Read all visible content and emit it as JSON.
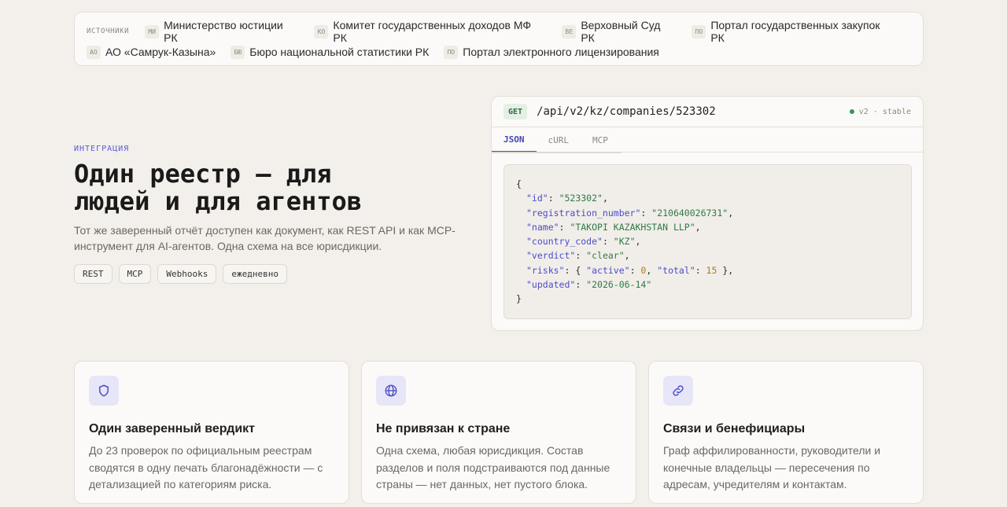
{
  "sources": {
    "label": "ИСТОЧНИКИ",
    "row1": [
      {
        "abbr": "МИ",
        "name": "Министерство юстиции РК"
      },
      {
        "abbr": "КО",
        "name": "Комитет государственных доходов МФ РК"
      },
      {
        "abbr": "ВЕ",
        "name": "Верховный Суд РК"
      },
      {
        "abbr": "ПО",
        "name": "Портал государственных закупок РК"
      }
    ],
    "row2": [
      {
        "abbr": "АО",
        "name": "АО «Самрук-Казына»"
      },
      {
        "abbr": "БЮ",
        "name": "Бюро национальной статистики РК"
      },
      {
        "abbr": "ПО",
        "name": "Портал электронного лицензирования"
      }
    ]
  },
  "integration": {
    "eyebrow": "ИНТЕГРАЦИЯ",
    "title_line1": "Один реестр — для",
    "title_line2": "людей и для агентов",
    "description": "Тот же заверенный отчёт доступен как документ, как REST API и как MCP-инструмент для AI-агентов. Одна схема на все юрисдикции.",
    "chips": [
      "REST",
      "MCP",
      "Webhooks",
      "ежедневно"
    ]
  },
  "api": {
    "method": "GET",
    "endpoint": "/api/v2/kz/companies/523302",
    "version": "v2 · stable",
    "status_color": "#2e9a58",
    "tabs": [
      "JSON",
      "cURL",
      "MCP"
    ],
    "active_tab": "JSON",
    "json": {
      "id": "\"523302\"",
      "registration_number": "\"210640026731\"",
      "name": "\"TAKOPI KAZAKHSTAN LLP\"",
      "country_code": "\"KZ\"",
      "verdict": "\"clear\"",
      "risks_active": "0",
      "risks_total": "15",
      "updated": "\"2026-06-14\""
    }
  },
  "features": [
    {
      "icon": "shield-icon",
      "title": "Один заверенный вердикт",
      "text": "До 23 проверок по официальным реестрам сводятся в одну печать благонадёжности — с детализацией по категориям риска."
    },
    {
      "icon": "globe-icon",
      "title": "Не привязан к стране",
      "text": "Одна схема, любая юрисдикция. Состав разделов и поля подстраиваются под данные страны — нет данных, нет пустого блока."
    },
    {
      "icon": "link-icon",
      "title": "Связи и бенефициары",
      "text": "Граф аффилированности, руководители и конечные владельцы — пересечения по адресам, учредителям и контактам."
    }
  ],
  "colors": {
    "accent": "#5b5bd6",
    "background": "#f3f0eb",
    "card": "#fbfaf8"
  }
}
